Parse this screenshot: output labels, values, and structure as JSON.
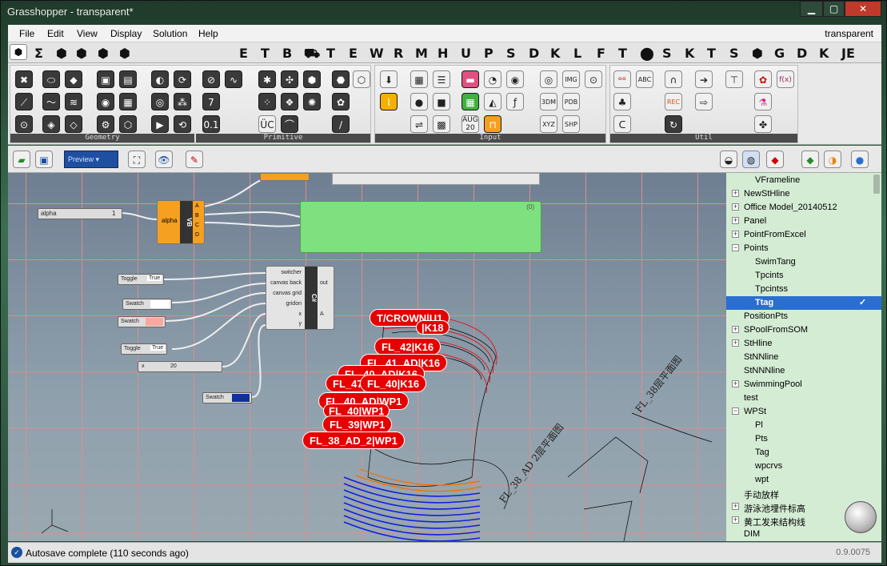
{
  "window": {
    "title": "Grasshopper - transparent*",
    "doc_name": "transparent"
  },
  "menu": {
    "items": [
      "File",
      "Edit",
      "View",
      "Display",
      "Solution",
      "Help"
    ]
  },
  "tabs": [
    "Σ",
    "⬢",
    "⬢",
    "⬢",
    "⬢",
    "E",
    "T",
    "B",
    "⛟",
    "T",
    "E",
    "W",
    "R",
    "M",
    "H",
    "U",
    "P",
    "S",
    "D",
    "K",
    "L",
    "F",
    "T",
    "⬤",
    "S",
    "K",
    "T",
    "S",
    "⬢",
    "G",
    "D",
    "K",
    "JE"
  ],
  "ribbon": {
    "panels": [
      "Geometry",
      "Primitive",
      "Input",
      "Util"
    ]
  },
  "toolbar2": {
    "preview_label": "Preview"
  },
  "canvas": {
    "nodes": {
      "alpha_slider": {
        "label": "alpha",
        "value": "1"
      },
      "vb": {
        "input": "alpha",
        "title": "VB",
        "outputs": [
          "A",
          "B",
          "C",
          "D"
        ]
      },
      "toggle1": {
        "label": "Toggle",
        "value": "True"
      },
      "swatch1": {
        "label": "Swatch"
      },
      "swatch2": {
        "label": "Swatch"
      },
      "toggle2": {
        "label": "Toggle",
        "value": "True"
      },
      "x_slider": {
        "label": "x",
        "value": "20"
      },
      "swatch3": {
        "label": "Swatch"
      },
      "csharp": {
        "title": "C#",
        "inputs": [
          "switcher",
          "canvas back",
          "canvas grid",
          "gridon",
          "x",
          "y"
        ],
        "outputs": [
          "out",
          "A"
        ]
      },
      "panel": {
        "value": "(0)"
      }
    },
    "tags": [
      "T/CROWN|U1",
      "|K18",
      "FL_42|K16",
      "FL_41_AD|K16",
      "FL_40_AD|K16",
      "FL_47",
      "FL_40|K16",
      "FL_40_AD|WP1",
      "FL_40|WP1",
      "FL_39|WP1",
      "FL_38_AD_2|WP1"
    ],
    "drawing_texts": [
      "FL_38_AD 2层平面图",
      "FL_38层平面图"
    ]
  },
  "tree": {
    "items": [
      {
        "label": "VFrameline",
        "level": 2,
        "expander": false
      },
      {
        "label": "NewStHline",
        "level": 1,
        "expander": true,
        "sign": "+"
      },
      {
        "label": "Office Model_20140512",
        "level": 1,
        "expander": true,
        "sign": "+"
      },
      {
        "label": "Panel",
        "level": 1,
        "expander": true,
        "sign": "+"
      },
      {
        "label": "PointFromExcel",
        "level": 1,
        "expander": true,
        "sign": "+"
      },
      {
        "label": "Points",
        "level": 1,
        "expander": true,
        "sign": "−"
      },
      {
        "label": "SwimTang",
        "level": 2,
        "expander": false
      },
      {
        "label": "Tpcints",
        "level": 2,
        "expander": false
      },
      {
        "label": "Tpcintss",
        "level": 2,
        "expander": false
      },
      {
        "label": "Ttag",
        "level": 2,
        "expander": false,
        "selected": true
      },
      {
        "label": "PositionPts",
        "level": 1,
        "expander": false
      },
      {
        "label": "SPoolFromSOM",
        "level": 1,
        "expander": true,
        "sign": "+"
      },
      {
        "label": "StHline",
        "level": 1,
        "expander": true,
        "sign": "+"
      },
      {
        "label": "StNNline",
        "level": 1,
        "expander": false
      },
      {
        "label": "StNNNline",
        "level": 1,
        "expander": false
      },
      {
        "label": "SwimmingPool",
        "level": 1,
        "expander": true,
        "sign": "+"
      },
      {
        "label": "test",
        "level": 1,
        "expander": false
      },
      {
        "label": "WPSt",
        "level": 1,
        "expander": true,
        "sign": "−"
      },
      {
        "label": "Pl",
        "level": 2,
        "expander": false
      },
      {
        "label": "Pts",
        "level": 2,
        "expander": false
      },
      {
        "label": "Tag",
        "level": 2,
        "expander": false
      },
      {
        "label": "wpcrvs",
        "level": 2,
        "expander": false
      },
      {
        "label": "wpt",
        "level": 2,
        "expander": false
      },
      {
        "label": "手动放样",
        "level": 1,
        "expander": false
      },
      {
        "label": "游泳池埋件标高",
        "level": 1,
        "expander": true,
        "sign": "+"
      },
      {
        "label": "黄工发来结构线",
        "level": 1,
        "expander": true,
        "sign": "+"
      },
      {
        "label": "DIM",
        "level": 1,
        "expander": false
      }
    ]
  },
  "status": {
    "message": "Autosave complete (110 seconds ago)",
    "version": "0.9.0075"
  },
  "colors": {
    "accent": "#2a6ed0",
    "tag": "#e60000",
    "panel_green": "#7ee07e",
    "vb_orange": "#f5a020"
  }
}
